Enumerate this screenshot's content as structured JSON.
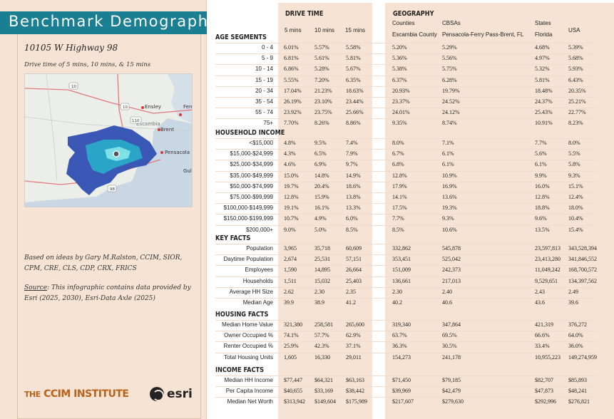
{
  "title": "Benchmark Demographics",
  "address": "10105 W Highway 98",
  "drive_time_text": "Drive time of 5 mins, 10 mins, & 15 mins",
  "credits": "Based on ideas by Gary M.Ralston, CCIM, SIOR, CPM, CRE, CLS, CDP, CRX, FRICS",
  "source_label": "Source",
  "source_text": ": This infographic contains data provided by Esri (2025, 2030), Esri-Data Axle (2025)",
  "logo_ccim_the": "THE",
  "logo_ccim_name": "CCIM INSTITUTE",
  "logo_esri": "esri",
  "map": {
    "labels": [
      "Ensley",
      "Ferry",
      "Escambia",
      "Brent",
      "Pensacola",
      "Gulf"
    ],
    "road_shields": [
      "10",
      "10",
      "110",
      "98"
    ]
  },
  "header": {
    "drive_time": "DRIVE TIME",
    "geography": "GEOGRAPHY",
    "drive_cols": [
      "5 mins",
      "10 mins",
      "15 mins"
    ],
    "geo_types": [
      "Counties",
      "CBSAs",
      "States"
    ],
    "geo_names": [
      "Escambia County",
      "Pensacola-Ferry Pass-Brent, FL",
      "Florida",
      "USA"
    ]
  },
  "sections": [
    {
      "title": "AGE SEGMENTS",
      "rows": [
        {
          "label": "0 - 4",
          "values": [
            "6.01%",
            "5.57%",
            "5.58%",
            "5.20%",
            "5.29%",
            "4.68%",
            "5.39%"
          ]
        },
        {
          "label": "5 - 9",
          "values": [
            "6.81%",
            "5.61%",
            "5.81%",
            "5.36%",
            "5.56%",
            "4.97%",
            "5.68%"
          ]
        },
        {
          "label": "10 - 14",
          "values": [
            "6.86%",
            "5.28%",
            "5.67%",
            "5.38%",
            "5.75%",
            "5.32%",
            "5.93%"
          ]
        },
        {
          "label": "15 - 19",
          "values": [
            "5.55%",
            "7.20%",
            "6.35%",
            "6.37%",
            "6.28%",
            "5.81%",
            "6.43%"
          ]
        },
        {
          "label": "20 - 34",
          "values": [
            "17.04%",
            "21.23%",
            "18.63%",
            "20.93%",
            "19.79%",
            "18.48%",
            "20.35%"
          ]
        },
        {
          "label": "35 - 54",
          "values": [
            "26.19%",
            "23.10%",
            "23.44%",
            "23.37%",
            "24.52%",
            "24.37%",
            "25.21%"
          ]
        },
        {
          "label": "55 - 74",
          "values": [
            "23.92%",
            "23.75%",
            "25.66%",
            "24.01%",
            "24.12%",
            "25.43%",
            "22.77%"
          ]
        },
        {
          "label": "75+",
          "values": [
            "7.70%",
            "8.26%",
            "8.86%",
            "9.35%",
            "8.74%",
            "10.91%",
            "8.23%"
          ]
        }
      ]
    },
    {
      "title": "HOUSEHOLD INCOME",
      "rows": [
        {
          "label": "<$15,000",
          "values": [
            "4.8%",
            "9.5%",
            "7.4%",
            "8.0%",
            "7.1%",
            "7.7%",
            "8.0%"
          ]
        },
        {
          "label": "$15,000-$24,999",
          "values": [
            "4.3%",
            "6.5%",
            "7.9%",
            "6.7%",
            "6.1%",
            "5.6%",
            "5.5%"
          ]
        },
        {
          "label": "$25,000-$34,999",
          "values": [
            "4.6%",
            "6.9%",
            "9.7%",
            "6.8%",
            "6.1%",
            "6.1%",
            "5.8%"
          ]
        },
        {
          "label": "$35,000-$49,999",
          "values": [
            "15.0%",
            "14.8%",
            "14.9%",
            "12.8%",
            "10.9%",
            "9.9%",
            "9.3%"
          ]
        },
        {
          "label": "$50,000-$74,999",
          "values": [
            "19.7%",
            "20.4%",
            "18.6%",
            "17.9%",
            "16.9%",
            "16.0%",
            "15.1%"
          ]
        },
        {
          "label": "$75,000-$99,999",
          "values": [
            "12.8%",
            "15.9%",
            "13.8%",
            "14.1%",
            "13.6%",
            "12.8%",
            "12.4%"
          ]
        },
        {
          "label": "$100,000-$149,999",
          "values": [
            "19.1%",
            "16.1%",
            "13.3%",
            "17.5%",
            "19.3%",
            "18.8%",
            "18.0%"
          ]
        },
        {
          "label": "$150,000-$199,999",
          "values": [
            "10.7%",
            "4.9%",
            "6.0%",
            "7.7%",
            "9.3%",
            "9.6%",
            "10.4%"
          ]
        },
        {
          "label": "$200,000+",
          "values": [
            "9.0%",
            "5.0%",
            "8.5%",
            "8.5%",
            "10.6%",
            "13.5%",
            "15.4%"
          ]
        }
      ]
    },
    {
      "title": "KEY FACTS",
      "rows": [
        {
          "label": "Population",
          "values": [
            "3,965",
            "35,718",
            "60,609",
            "332,862",
            "545,878",
            "23,597,813",
            "343,528,394"
          ]
        },
        {
          "label": "Daytime Population",
          "values": [
            "2,674",
            "25,531",
            "57,151",
            "353,451",
            "525,042",
            "23,413,280",
            "341,846,552"
          ]
        },
        {
          "label": "Employees",
          "values": [
            "1,590",
            "14,895",
            "26,664",
            "151,009",
            "242,373",
            "11,049,242",
            "168,700,572"
          ]
        },
        {
          "label": "Households",
          "values": [
            "1,511",
            "15,032",
            "25,403",
            "136,661",
            "217,013",
            "9,529,651",
            "134,397,562"
          ]
        },
        {
          "label": "Average HH Size",
          "values": [
            "2.62",
            "2.30",
            "2.35",
            "2.30",
            "2.40",
            "2.43",
            "2.49"
          ]
        },
        {
          "label": "Median Age",
          "values": [
            "39.9",
            "38.9",
            "41.2",
            "40.2",
            "40.6",
            "43.6",
            "39.6"
          ]
        }
      ]
    },
    {
      "title": "HOUSING FACTS",
      "rows": [
        {
          "label": "Median Home Value",
          "values": [
            "321,380",
            "258,581",
            "265,600",
            "319,340",
            "347,864",
            "421,319",
            "376,272"
          ]
        },
        {
          "label": "Owner Occupied %",
          "values": [
            "74.1%",
            "57.7%",
            "62.9%",
            "63.7%",
            "69.5%",
            "66.6%",
            "64.0%"
          ]
        },
        {
          "label": "Renter Occupied %",
          "values": [
            "25.9%",
            "42.3%",
            "37.1%",
            "36.3%",
            "30.5%",
            "33.4%",
            "36.0%"
          ]
        },
        {
          "label": "Total Housing Units",
          "values": [
            "1,605",
            "16,330",
            "29,011",
            "154,273",
            "241,178",
            "10,955,223",
            "149,274,959"
          ]
        }
      ]
    },
    {
      "title": "INCOME FACTS",
      "rows": [
        {
          "label": "Median HH Income",
          "values": [
            "$77,447",
            "$64,321",
            "$63,163",
            "$71,450",
            "$79,185",
            "$82,707",
            "$85,893"
          ]
        },
        {
          "label": "Per Capita Income",
          "values": [
            "$40,655",
            "$33,169",
            "$38,442",
            "$39,969",
            "$42,479",
            "$47,873",
            "$48,241"
          ]
        },
        {
          "label": "Median Net Worth",
          "values": [
            "$313,942",
            "$149,604",
            "$175,989",
            "$217,607",
            "$279,630",
            "$292,996",
            "$276,821"
          ]
        }
      ]
    }
  ]
}
